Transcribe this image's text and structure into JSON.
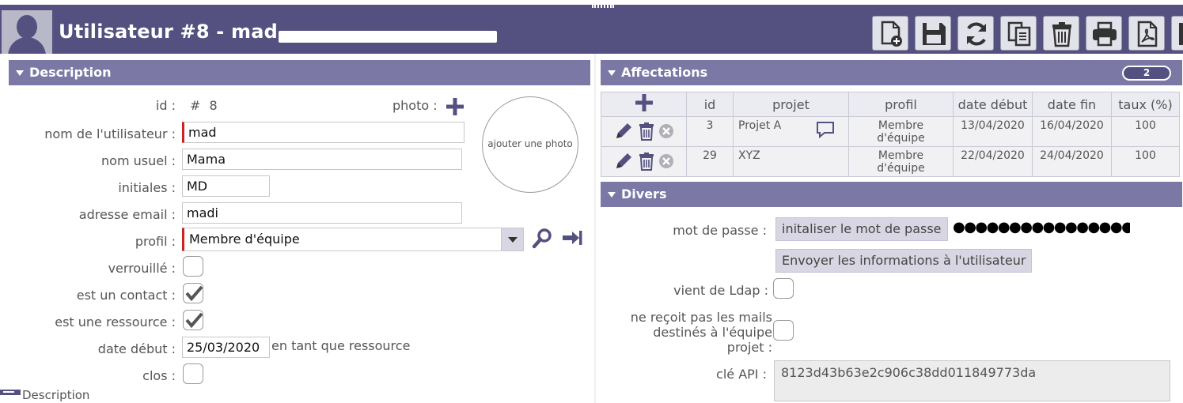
{
  "header": {
    "title": "Utilisateur  #8 - mad",
    "toolbar": [
      {
        "name": "new-file-button",
        "icon": "new-document-icon"
      },
      {
        "name": "save-button",
        "icon": "floppy-disk-icon"
      },
      {
        "name": "refresh-button",
        "icon": "refresh-icon"
      },
      {
        "name": "copy-button",
        "icon": "copy-documents-icon"
      },
      {
        "name": "delete-button",
        "icon": "trash-icon"
      },
      {
        "name": "print-button",
        "icon": "printer-icon"
      },
      {
        "name": "pdf-button",
        "icon": "pdf-icon"
      },
      {
        "name": "more-button",
        "icon": "partial-icon"
      }
    ]
  },
  "description": {
    "section_title": "Description",
    "id_label": "id :",
    "id_value": "# 8",
    "photo_label": "photo :",
    "photo_placeholder": "ajouter une photo",
    "nom_label": "nom de l'utilisateur :",
    "nom_value": "mad",
    "nom_usuel_label": "nom usuel :",
    "nom_usuel_value": "Mama",
    "initiales_label": "initiales :",
    "initiales_value": "MD",
    "email_label": "adresse email :",
    "email_value": "madi",
    "profil_label": "profil :",
    "profil_value": "Membre d'équipe",
    "verrouille_label": "verrouillé :",
    "verrouille_checked": false,
    "contact_label": "est un contact :",
    "contact_checked": true,
    "ressource_label": "est une ressource :",
    "ressource_checked": true,
    "date_debut_label": "date début :",
    "date_debut_value": "25/03/2020",
    "date_debut_suffix": "en tant que ressource",
    "clos_label": "clos :",
    "clos_checked": false,
    "bottom_tab": "Description"
  },
  "affectations": {
    "section_title": "Affectations",
    "count": "2",
    "columns": [
      "id",
      "projet",
      "profil",
      "date début",
      "date fin",
      "taux (%)"
    ],
    "rows": [
      {
        "id": "3",
        "projet": "Projet A",
        "profil": "Membre d'équipe",
        "date_debut": "13/04/2020",
        "date_fin": "16/04/2020",
        "taux": "100",
        "has_comment": true
      },
      {
        "id": "29",
        "projet": "XYZ",
        "profil": "Membre d'équipe",
        "date_debut": "22/04/2020",
        "date_fin": "24/04/2020",
        "taux": "100",
        "has_comment": false
      }
    ]
  },
  "divers": {
    "section_title": "Divers",
    "mot_de_passe_label": "mot de passe :",
    "init_password_button": "initaliser le mot de passe",
    "password_mask": "●●●●●●●●●●●●●●●●●●●●●●●●●",
    "send_info_button": "Envoyer les informations à l'utilisateur",
    "ldap_label": "vient de Ldap :",
    "ldap_checked": false,
    "no_mail_label_1": "ne reçoit pas les mails",
    "no_mail_label_2": "destinés à l'équipe",
    "no_mail_label_3": "projet :",
    "no_mail_checked": false,
    "api_label": "clé API :",
    "api_value": "8123d43b63e2c906c38dd011849773da"
  },
  "colors": {
    "header_bg": "#545180",
    "section_bg": "#7b78a6",
    "required_marker": "#cc2222",
    "button_bg": "#d8d6e2"
  }
}
